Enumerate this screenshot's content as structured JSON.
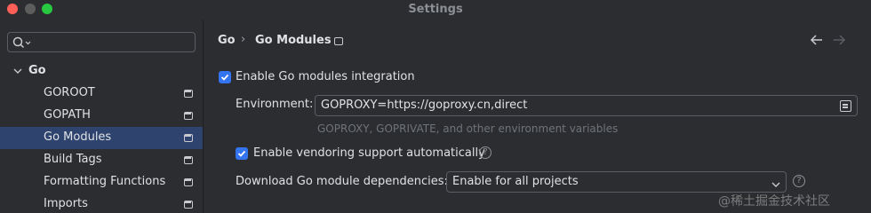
{
  "window": {
    "title": "Settings"
  },
  "sidebar": {
    "search": {
      "value": "",
      "placeholder": ""
    },
    "tree": [
      {
        "label": "Go",
        "expanded": true,
        "selected": false
      },
      {
        "label": "GOROOT",
        "selected": false
      },
      {
        "label": "GOPATH",
        "selected": false
      },
      {
        "label": "Go Modules",
        "selected": true
      },
      {
        "label": "Build Tags",
        "selected": false
      },
      {
        "label": "Formatting Functions",
        "selected": false
      },
      {
        "label": "Imports",
        "selected": false
      }
    ]
  },
  "main": {
    "breadcrumb": {
      "parent": "Go",
      "separator": "›",
      "current": "Go Modules"
    },
    "enable_modules": {
      "label": "Enable Go modules integration",
      "checked": true
    },
    "environment": {
      "label": "Environment:",
      "value": "GOPROXY=https://goproxy.cn,direct",
      "hint": "GOPROXY, GOPRIVATE, and other environment variables"
    },
    "vendoring": {
      "label": "Enable vendoring support automatically",
      "checked": true
    },
    "download": {
      "label": "Download Go module dependencies:",
      "selected": "Enable for all projects"
    }
  },
  "colors": {
    "accent": "#3574f0",
    "selection": "#2e436e",
    "background": "#2b2d30"
  },
  "watermark": "@稀土掘金技术社区"
}
